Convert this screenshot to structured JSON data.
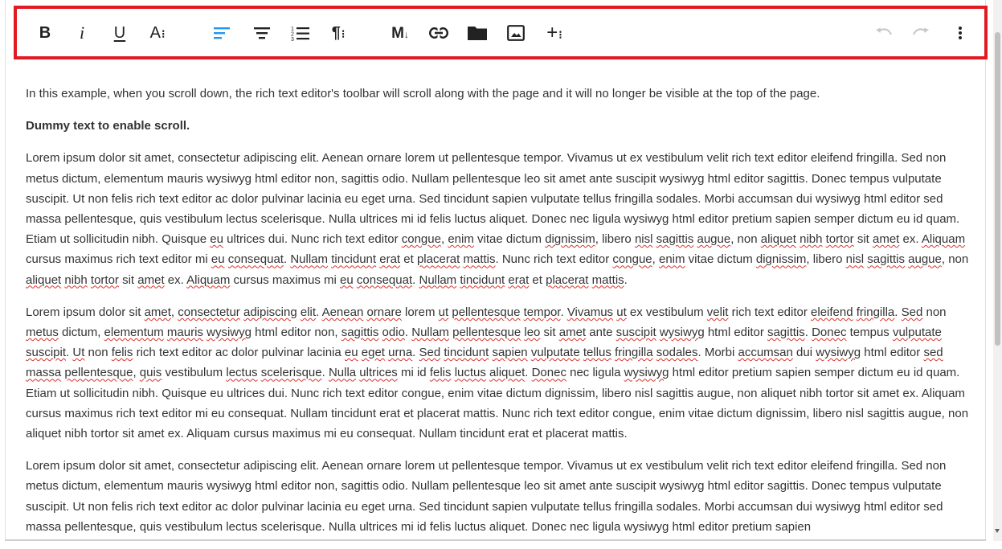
{
  "toolbar": {
    "bold": "B",
    "italic": "i",
    "underline": "U",
    "font_size": "A",
    "paragraph": "¶",
    "markdown": "M",
    "more": "+",
    "dots": "⁝",
    "highlight_color": "#e21b23",
    "active_color": "#2196f3"
  },
  "content": {
    "intro": "In this example, when you scroll down, the rich text editor's toolbar will scroll along with the page and it will no longer be visible at the top of the page.",
    "heading": "Dummy text to enable scroll.",
    "paragraphs": [
      "Lorem ipsum dolor sit amet, consectetur adipiscing elit. Aenean ornare lorem ut pellentesque tempor. Vivamus ut ex vestibulum velit rich text editor eleifend fringilla. Sed non metus dictum, elementum mauris wysiwyg html editor non, sagittis odio. Nullam pellentesque leo sit amet ante suscipit wysiwyg html editor sagittis. Donec tempus vulputate suscipit. Ut non felis rich text editor ac dolor pulvinar lacinia eu eget urna. Sed tincidunt sapien vulputate tellus fringilla sodales. Morbi accumsan dui wysiwyg html editor sed massa pellentesque, quis vestibulum lectus scelerisque. Nulla ultrices mi id felis luctus aliquet. Donec nec ligula wysiwyg html editor pretium sapien semper dictum eu id quam. Etiam ut sollicitudin nibh. Quisque eu ultrices dui. Nunc rich text editor congue, enim vitae dictum dignissim, libero nisl sagittis augue, non aliquet nibh tortor sit amet ex. Aliquam cursus maximus rich text editor mi eu consequat. Nullam tincidunt erat et placerat mattis. Nunc rich text editor congue, enim vitae dictum dignissim, libero nisl sagittis augue, non aliquet nibh tortor sit amet ex. Aliquam cursus maximus mi eu consequat. Nullam tincidunt erat et placerat mattis.",
      "Lorem ipsum dolor sit amet, consectetur adipiscing elit. Aenean ornare lorem ut pellentesque tempor. Vivamus ut ex vestibulum velit rich text editor eleifend fringilla. Sed non metus dictum, elementum mauris wysiwyg html editor non, sagittis odio. Nullam pellentesque leo sit amet ante suscipit wysiwyg html editor sagittis. Donec tempus vulputate suscipit. Ut non felis rich text editor ac dolor pulvinar lacinia eu eget urna. Sed tincidunt sapien vulputate tellus fringilla sodales. Morbi accumsan dui wysiwyg html editor sed massa pellentesque, quis vestibulum lectus scelerisque. Nulla ultrices mi id felis luctus aliquet. Donec nec ligula wysiwyg html editor pretium sapien semper dictum eu id quam. Etiam ut sollicitudin nibh. Quisque eu ultrices dui. Nunc rich text editor congue, enim vitae dictum dignissim, libero nisl sagittis augue, non aliquet nibh tortor sit amet ex. Aliquam cursus maximus rich text editor mi eu consequat. Nullam tincidunt erat et placerat mattis. Nunc rich text editor congue, enim vitae dictum dignissim, libero nisl sagittis augue, non aliquet nibh tortor sit amet ex. Aliquam cursus maximus mi eu consequat. Nullam tincidunt erat et placerat mattis.",
      "Lorem ipsum dolor sit amet, consectetur adipiscing elit. Aenean ornare lorem ut pellentesque tempor. Vivamus ut ex vestibulum velit rich text editor eleifend fringilla. Sed non metus dictum, elementum mauris wysiwyg html editor non, sagittis odio. Nullam pellentesque leo sit amet ante suscipit wysiwyg html editor sagittis. Donec tempus vulputate suscipit. Ut non felis rich text editor ac dolor pulvinar lacinia eu eget urna. Sed tincidunt sapien vulputate tellus fringilla sodales. Morbi accumsan dui wysiwyg html editor sed massa pellentesque, quis vestibulum lectus scelerisque. Nulla ultrices mi id felis luctus aliquet. Donec nec ligula wysiwyg html editor pretium sapien"
    ]
  }
}
